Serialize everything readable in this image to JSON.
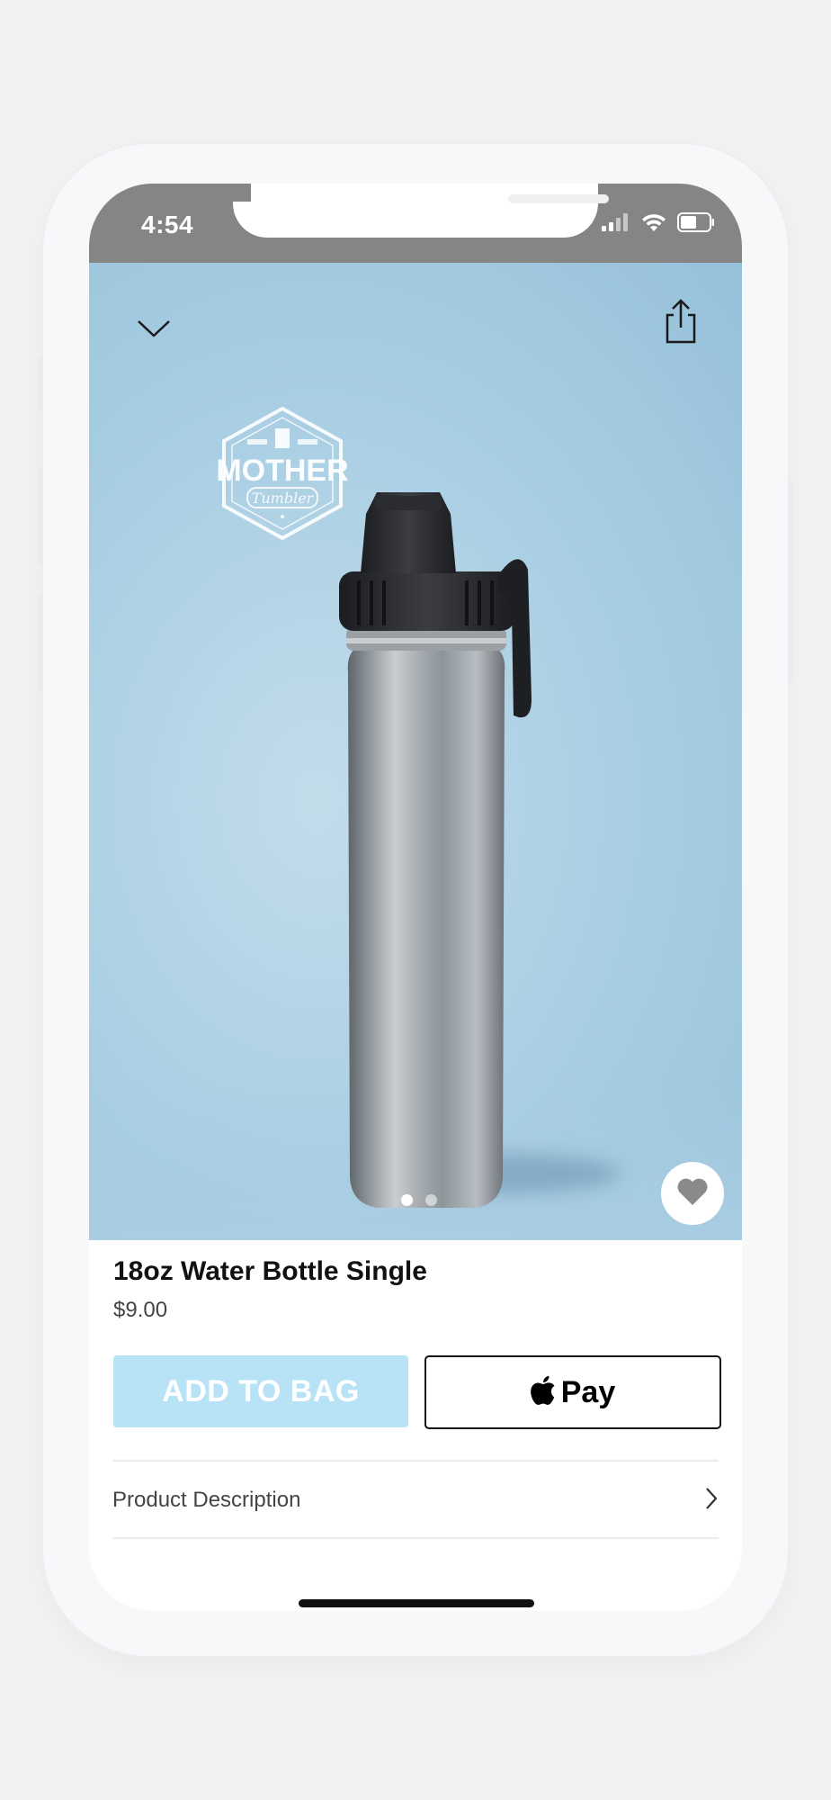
{
  "status_bar": {
    "time": "4:54"
  },
  "hero": {
    "brand_logo_text": "MOTHER Tumbler",
    "carousel": {
      "count": 2,
      "active_index": 0
    }
  },
  "product": {
    "title": "18oz Water Bottle Single",
    "price": "$9.00"
  },
  "actions": {
    "add_to_bag_label": "ADD TO BAG",
    "apple_pay_label": "Pay"
  },
  "details": {
    "description_label": "Product Description"
  },
  "colors": {
    "accent_button": "#b8e3f7",
    "status_bar": "#858585",
    "hero_background": "#a9cde3"
  }
}
